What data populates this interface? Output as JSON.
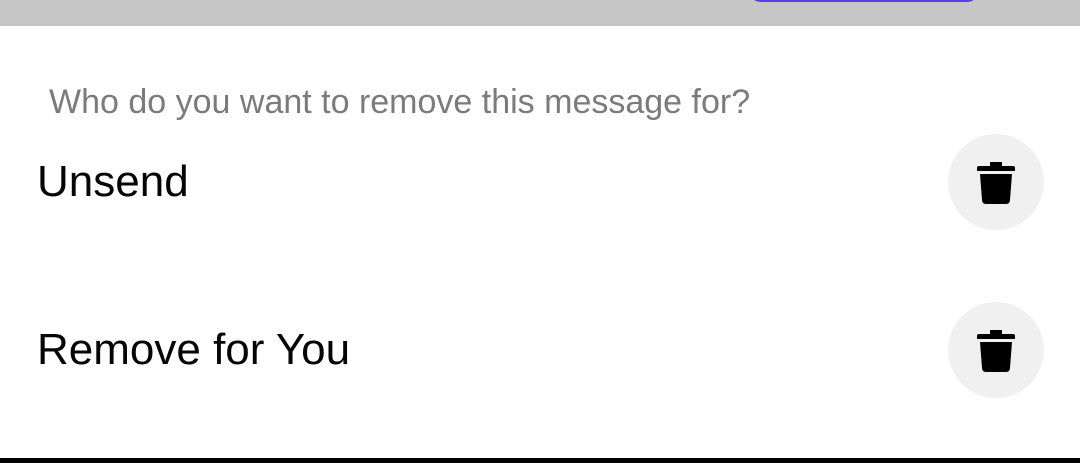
{
  "dialog": {
    "prompt": "Who do you want to remove this message for?",
    "options": [
      {
        "label": "Unsend",
        "icon": "trash-icon"
      },
      {
        "label": "Remove for You",
        "icon": "trash-icon"
      }
    ]
  },
  "colors": {
    "scrim": "#c6c6c6",
    "accent": "#5b3be8",
    "prompt_text": "#7b7b7b",
    "label_text": "#050505",
    "icon_bg": "#f0f0f0",
    "icon": "#000000"
  }
}
